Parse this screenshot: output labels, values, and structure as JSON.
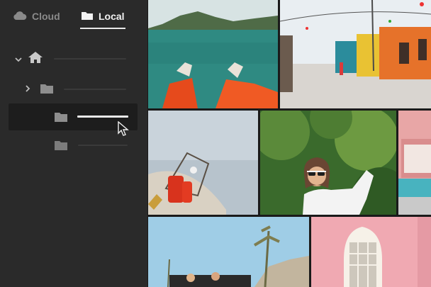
{
  "tabs": {
    "cloud": {
      "label": "Cloud",
      "icon": "cloud-icon"
    },
    "local": {
      "label": "Local",
      "icon": "folder-icon",
      "active": true
    }
  },
  "tree": [
    {
      "name": "home",
      "icon": "home-icon",
      "expander": "chevron-down-icon",
      "level": 0
    },
    {
      "name": "folder",
      "icon": "folder-icon",
      "expander": "chevron-right-icon",
      "level": 1
    },
    {
      "name": "folder",
      "icon": "folder-icon",
      "level": 2,
      "selected": true
    },
    {
      "name": "folder",
      "icon": "folder-icon",
      "level": 2
    }
  ],
  "gallery": {
    "photos": [
      {
        "subject": "lake-feet-photo"
      },
      {
        "subject": "colorful-street-photo"
      },
      {
        "subject": "boat-lobster-trap-photo"
      },
      {
        "subject": "woman-sunglasses-photo"
      },
      {
        "subject": "pink-building-photo"
      },
      {
        "subject": "desert-car-photo"
      },
      {
        "subject": "pink-wall-window-photo"
      }
    ]
  },
  "colors": {
    "sidebar_bg": "#2a2a2a",
    "active_text": "#f2f2f2",
    "inactive_text": "#8a8a8a",
    "selected_row": "#1d1d1d"
  }
}
